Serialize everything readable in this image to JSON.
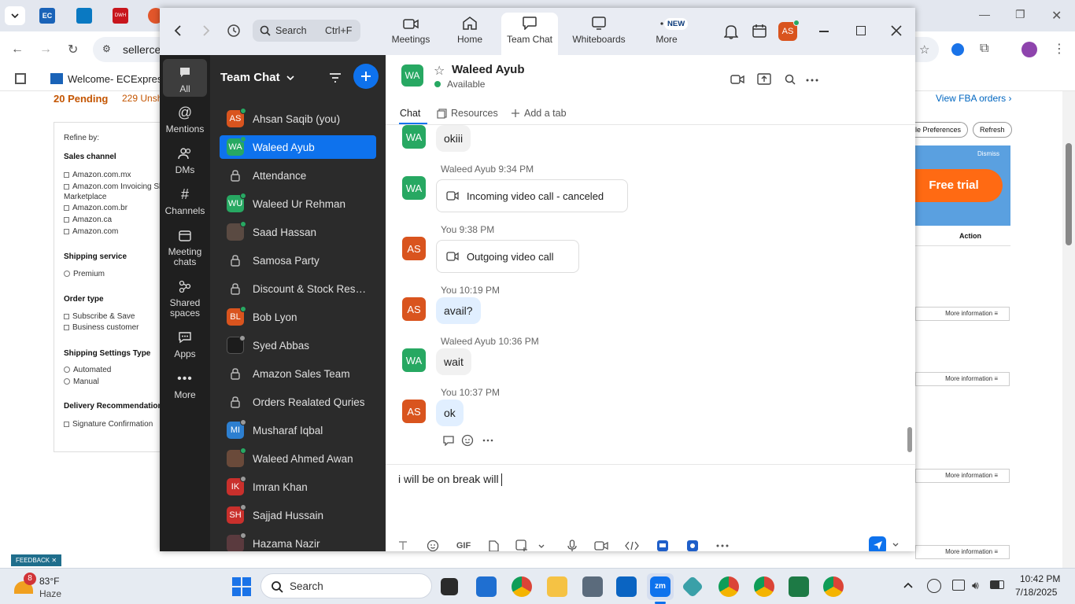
{
  "browser": {
    "address_partial": "sellerce",
    "bookmark_label": "Welcome- ECExpres...",
    "tab_abbrev": "EC",
    "tab_dwh": "DWH"
  },
  "seller": {
    "pending": "20 Pending",
    "unshipped": "229 Unsh",
    "view_fba": "View FBA orders ›",
    "refine_by": "Refine by:",
    "sales_channel": "Sales channel",
    "channels": [
      "Amazon.com.mx",
      "Amazon.com Invoicing Sh",
      "Marketplace",
      "Amazon.com.br",
      "Amazon.ca",
      "Amazon.com"
    ],
    "shipping_service": "Shipping service",
    "premium": "Premium",
    "order_type": "Order type",
    "subscribe": "Subscribe & Save",
    "business": "Business customer",
    "shipping_settings": "Shipping Settings Type",
    "automated": "Automated",
    "manual": "Manual",
    "delivery_rec": "Delivery Recommendation",
    "signature": "Signature Confirmation",
    "table_prefs": "ble Preferences",
    "refresh": "Refresh",
    "dismiss": "Dismiss",
    "free_trial": "Free trial",
    "action": "Action",
    "more_info": "More information ≡",
    "feedback": "FEEDBACK ✕"
  },
  "zoom": {
    "search": "Search",
    "search_shortcut": "Ctrl+F",
    "nav": [
      {
        "label": "Meetings"
      },
      {
        "label": "Home"
      },
      {
        "label": "Team Chat"
      },
      {
        "label": "Whiteboards"
      },
      {
        "label": "More"
      }
    ],
    "new_badge": "NEW",
    "user_initials": "AS",
    "rail": [
      {
        "label": "All"
      },
      {
        "label": "Mentions"
      },
      {
        "label": "DMs"
      },
      {
        "label": "Channels"
      },
      {
        "label": "Meeting chats"
      },
      {
        "label": "Shared spaces"
      },
      {
        "label": "Apps"
      },
      {
        "label": "More"
      }
    ],
    "list_title": "Team Chat",
    "contacts": [
      {
        "initials": "AS",
        "name": "Ahsan Saqib (you)"
      },
      {
        "initials": "WA",
        "name": "Waleed Ayub"
      },
      {
        "initials": "",
        "name": "Attendance"
      },
      {
        "initials": "WU",
        "name": "Waleed Ur Rehman"
      },
      {
        "initials": "",
        "name": "Saad Hassan"
      },
      {
        "initials": "",
        "name": "Samosa Party"
      },
      {
        "initials": "",
        "name": "Discount & Stock Reser..."
      },
      {
        "initials": "BL",
        "name": "Bob Lyon"
      },
      {
        "initials": "",
        "name": "Syed Abbas"
      },
      {
        "initials": "",
        "name": "Amazon Sales Team"
      },
      {
        "initials": "",
        "name": "Orders Realated Quries"
      },
      {
        "initials": "MI",
        "name": "Musharaf Iqbal"
      },
      {
        "initials": "",
        "name": "Waleed Ahmed Awan"
      },
      {
        "initials": "IK",
        "name": "Imran Khan"
      },
      {
        "initials": "SH",
        "name": "Sajjad Hussain"
      },
      {
        "initials": "",
        "name": "Hazama Nazir"
      }
    ],
    "chat": {
      "contact_initials": "WA",
      "contact_name": "Waleed Ayub",
      "status": "Available",
      "tabs": [
        "Chat",
        "Resources",
        "Add a tab"
      ],
      "messages": [
        {
          "sender": "WA",
          "meta": "",
          "text": "okiii"
        },
        {
          "sender": "WA",
          "meta": "Waleed Ayub 9:34 PM",
          "text": "Incoming video call - canceled"
        },
        {
          "sender": "AS",
          "meta": "You 9:38 PM",
          "text": "Outgoing video call"
        },
        {
          "sender": "AS",
          "meta": "You 10:19 PM",
          "text": "avail?"
        },
        {
          "sender": "WA",
          "meta": "Waleed Ayub 10:36 PM",
          "text": "wait"
        },
        {
          "sender": "AS",
          "meta": "You 10:37 PM",
          "text": "ok"
        }
      ],
      "compose_text": "i will be on break will",
      "gif_label": "GIF"
    }
  },
  "taskbar": {
    "weather_badge": "8",
    "temperature": "83°F",
    "condition": "Haze",
    "search": "Search",
    "time": "10:42 PM",
    "date": "7/18/2025"
  },
  "colors": {
    "zoom_blue": "#0e72ed",
    "avatar_green": "#27a862",
    "avatar_orange": "#d9541e",
    "rail_dark": "#1f1f1f",
    "list_dark": "#2b2b2b"
  }
}
